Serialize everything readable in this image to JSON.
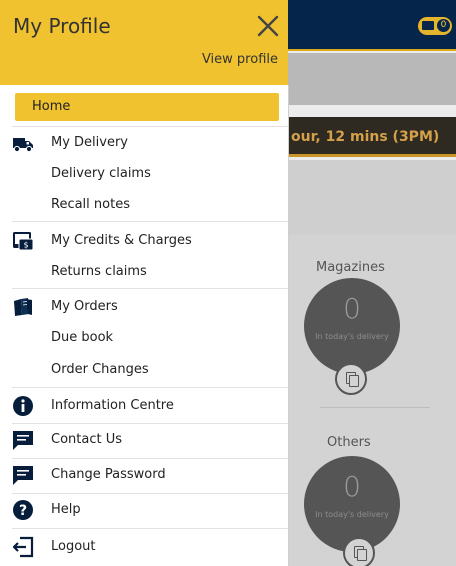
{
  "background": {
    "notification_count": "0",
    "cutoff_text": "our, 12 mins (3PM)",
    "sections": [
      {
        "title": "Magazines",
        "count": "0",
        "caption": "In today's delivery"
      },
      {
        "title": "Others",
        "count": "0",
        "caption": "In today's delivery"
      }
    ]
  },
  "drawer": {
    "title": "My Profile",
    "view_profile": "View profile",
    "items": [
      {
        "label": "Home",
        "active": true
      },
      {
        "label": "My Delivery",
        "icon": "delivery-truck-icon"
      },
      {
        "label": "Delivery claims"
      },
      {
        "label": "Recall notes"
      },
      {
        "label": "My Credits & Charges",
        "icon": "credit-card-icon"
      },
      {
        "label": "Returns claims"
      },
      {
        "label": "My Orders",
        "icon": "newspapers-icon"
      },
      {
        "label": "Due book"
      },
      {
        "label": "Order Changes"
      },
      {
        "label": "Information Centre",
        "icon": "info-icon"
      },
      {
        "label": "Contact Us",
        "icon": "chat-icon"
      },
      {
        "label": "Change Password",
        "icon": "chat-icon"
      },
      {
        "label": "Help",
        "icon": "help-icon"
      },
      {
        "label": "Logout",
        "icon": "logout-icon"
      }
    ]
  },
  "colors": {
    "accent": "#f0c22f",
    "topbar": "#05254a",
    "icon": "#061e3c"
  }
}
